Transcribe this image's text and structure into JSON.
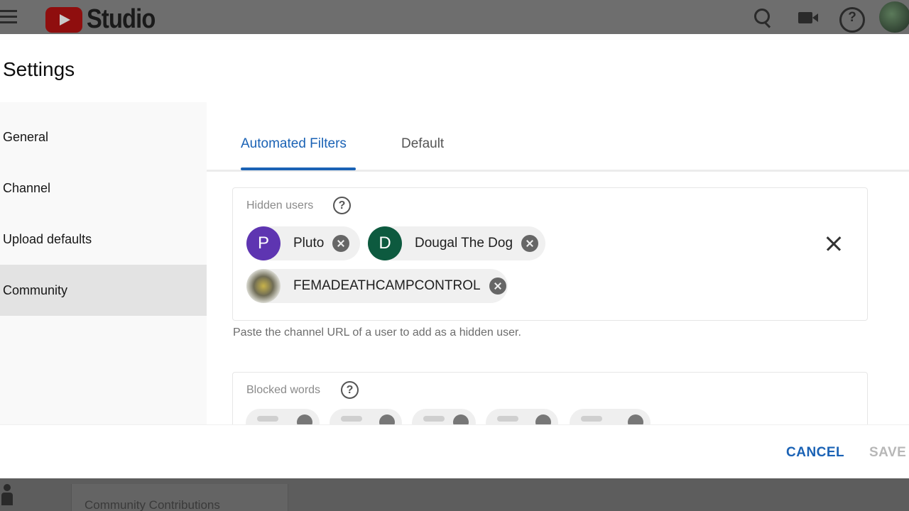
{
  "app": {
    "logo_text": "Studio",
    "logo_icon": "youtube-play-icon",
    "header_icons": [
      "hamburger-menu-icon",
      "search-icon",
      "create-video-icon",
      "help-icon",
      "account-avatar"
    ]
  },
  "modal": {
    "title": "Settings",
    "sidebar": {
      "items": [
        {
          "label": "General",
          "active": false
        },
        {
          "label": "Channel",
          "active": false
        },
        {
          "label": "Upload defaults",
          "active": false
        },
        {
          "label": "Community",
          "active": true
        }
      ]
    },
    "tabs": [
      {
        "label": "Automated Filters",
        "active": true
      },
      {
        "label": "Default",
        "active": false
      }
    ],
    "hidden_users": {
      "label": "Hidden users",
      "chips": [
        {
          "initial": "P",
          "name": "Pluto",
          "color": "#5e35b1"
        },
        {
          "initial": "D",
          "name": "Dougal The Dog",
          "color": "#0d5a3f"
        },
        {
          "initial": "",
          "name": "FEMADEATHCAMPCONTROL",
          "color": "#9a9a80"
        }
      ],
      "hint": "Paste the channel URL of a user to add as a hidden user."
    },
    "blocked_words": {
      "label": "Blocked words"
    },
    "footer": {
      "cancel_label": "CANCEL",
      "save_label": "SAVE"
    }
  },
  "background": {
    "bottom_text": "Community Contributions"
  },
  "colors": {
    "accent": "#1a62b5",
    "active_sidebar": "#e3e3e3",
    "chip_bg": "#f0f0f0"
  }
}
